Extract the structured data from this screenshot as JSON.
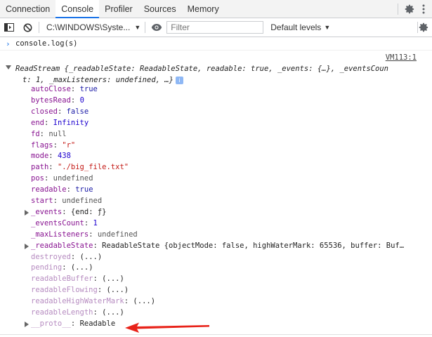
{
  "tabs": [
    {
      "label": "Connection",
      "active": false
    },
    {
      "label": "Console",
      "active": true
    },
    {
      "label": "Profiler",
      "active": false
    },
    {
      "label": "Sources",
      "active": false
    },
    {
      "label": "Memory",
      "active": false
    }
  ],
  "toolbar": {
    "context": "C:\\WINDOWS\\Syste...",
    "filter_placeholder": "Filter",
    "levels": "Default levels"
  },
  "console": {
    "prompt": "console.log(s)",
    "source_link": "VM113:1",
    "header_line1": "ReadStream {_readableState: ReadableState, readable: true, _events: {…}, _eventsCoun",
    "header_line2": "t: 1, _maxListeners: undefined, …}",
    "info_badge": "i",
    "properties": [
      {
        "key": "autoClose",
        "value": "true",
        "type": "bool"
      },
      {
        "key": "bytesRead",
        "value": "0",
        "type": "num"
      },
      {
        "key": "closed",
        "value": "false",
        "type": "bool"
      },
      {
        "key": "end",
        "value": "Infinity",
        "type": "num"
      },
      {
        "key": "fd",
        "value": "null",
        "type": "null"
      },
      {
        "key": "flags",
        "value": "\"r\"",
        "type": "str"
      },
      {
        "key": "mode",
        "value": "438",
        "type": "num"
      },
      {
        "key": "path",
        "value": "\"./big_file.txt\"",
        "type": "str"
      },
      {
        "key": "pos",
        "value": "undefined",
        "type": "undef"
      },
      {
        "key": "readable",
        "value": "true",
        "type": "bool"
      },
      {
        "key": "start",
        "value": "undefined",
        "type": "undef"
      },
      {
        "key": "_events",
        "value": "{end: ƒ}",
        "type": "obj",
        "expandable": true
      },
      {
        "key": "_eventsCount",
        "value": "1",
        "type": "num"
      },
      {
        "key": "_maxListeners",
        "value": "undefined",
        "type": "undef"
      },
      {
        "key": "_readableState",
        "value": "ReadableState {objectMode: false, highWaterMark: 65536, buffer: Buf…",
        "type": "obj",
        "expandable": true
      },
      {
        "key": "destroyed",
        "value": "(...)",
        "type": "obj",
        "dim": true
      },
      {
        "key": "pending",
        "value": "(...)",
        "type": "obj",
        "dim": true
      },
      {
        "key": "readableBuffer",
        "value": "(...)",
        "type": "obj",
        "dim": true
      },
      {
        "key": "readableFlowing",
        "value": "(...)",
        "type": "obj",
        "dim": true
      },
      {
        "key": "readableHighWaterMark",
        "value": "(...)",
        "type": "obj",
        "dim": true
      },
      {
        "key": "readableLength",
        "value": "(...)",
        "type": "obj",
        "dim": true
      },
      {
        "key": "__proto__",
        "value": "Readable",
        "type": "obj",
        "expandable": true,
        "dim": true
      }
    ]
  },
  "colors": {
    "accent": "#1a73e8",
    "annotation_arrow": "#e8231a"
  }
}
